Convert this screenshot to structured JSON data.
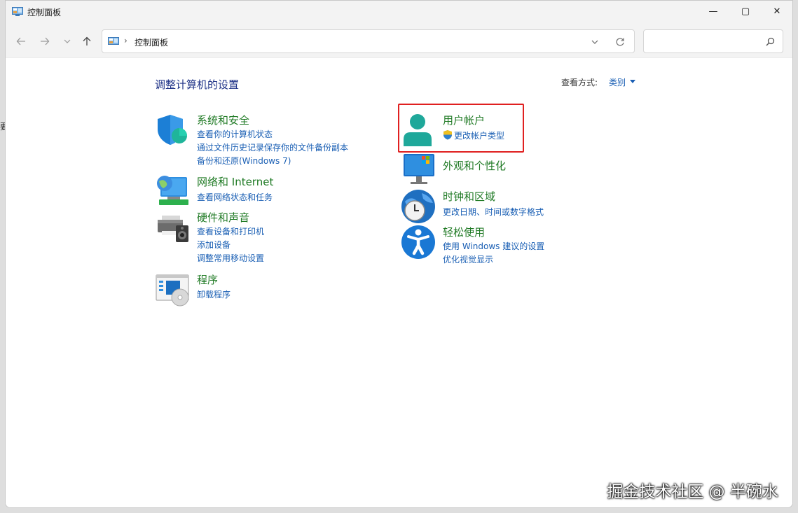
{
  "window": {
    "title": "控制面板",
    "controls": {
      "minimize": "—",
      "maximize": "▢",
      "close": "✕"
    }
  },
  "navbar": {
    "breadcrumb": "控制面板",
    "breadcrumb_sep": "›",
    "search_placeholder": ""
  },
  "main": {
    "heading": "调整计算机的设置",
    "view_by_label": "查看方式:",
    "view_by_value": "类别"
  },
  "categories": {
    "system_security": {
      "title": "系统和安全",
      "links": [
        "查看你的计算机状态",
        "通过文件历史记录保存你的文件备份副本",
        "备份和还原(Windows 7)"
      ]
    },
    "network": {
      "title": "网络和 Internet",
      "links": [
        "查看网络状态和任务"
      ]
    },
    "hardware": {
      "title": "硬件和声音",
      "links": [
        "查看设备和打印机",
        "添加设备",
        "调整常用移动设置"
      ]
    },
    "programs": {
      "title": "程序",
      "links": [
        "卸载程序"
      ]
    },
    "user_accounts": {
      "title": "用户帐户",
      "links": [
        "更改帐户类型"
      ]
    },
    "appearance": {
      "title": "外观和个性化",
      "links": []
    },
    "clock_region": {
      "title": "时钟和区域",
      "links": [
        "更改日期、时间或数字格式"
      ]
    },
    "ease_access": {
      "title": "轻松使用",
      "links": [
        "使用 Windows 建议的设置",
        "优化视觉显示"
      ]
    }
  },
  "overlay": {
    "watermark": "掘金技术社区 @ 半碗水",
    "left_edge_glyph": "要"
  },
  "colors": {
    "category_title": "#1f7a24",
    "link": "#1a5fb4",
    "heading": "#1e3287",
    "highlight": "#e02020"
  }
}
